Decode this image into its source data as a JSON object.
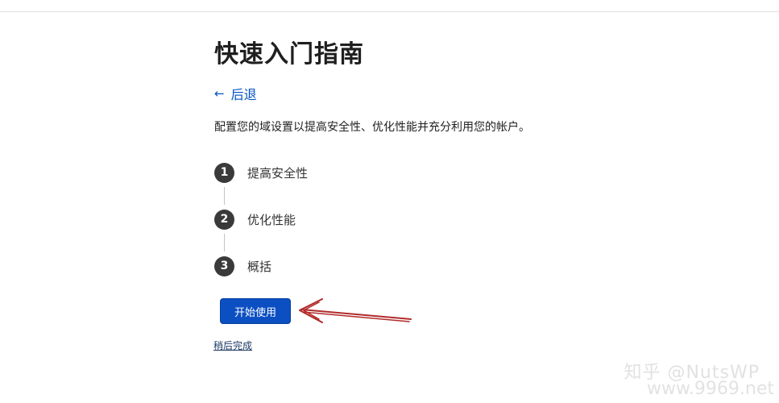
{
  "header": {
    "title": "快速入门指南"
  },
  "navigation": {
    "back_label": "后退",
    "back_icon": "arrow-left-icon"
  },
  "intro": {
    "description": "配置您的域设置以提高安全性、优化性能并充分利用您的帐户。"
  },
  "steps": [
    {
      "number": "1",
      "label": "提高安全性"
    },
    {
      "number": "2",
      "label": "优化性能"
    },
    {
      "number": "3",
      "label": "概括"
    }
  ],
  "actions": {
    "start_label": "开始使用",
    "later_label": "稍后完成"
  },
  "watermark": {
    "text": "知乎 @NutsWP",
    "url": "www.9969.net"
  },
  "colors": {
    "accent": "#0b4fc2",
    "link": "#0051c3",
    "step_circle": "#3a3a3a",
    "annotation_arrow": "#b22a2a"
  }
}
